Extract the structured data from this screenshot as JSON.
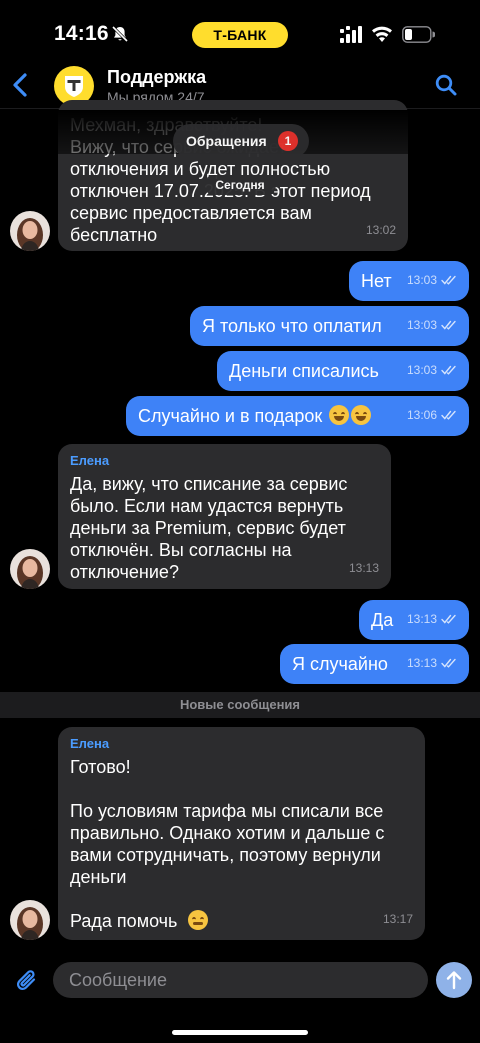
{
  "status_bar": {
    "time": "14:16",
    "carrier_pill": "Т-БАНК",
    "icons": [
      "bell-slash-icon",
      "signal-icon",
      "wifi-icon",
      "battery-icon"
    ]
  },
  "header": {
    "title": "Поддержка",
    "subtitle": "Мы рядом 24/7",
    "logo_letter": "Т"
  },
  "overlay": {
    "appeals_label": "Обращения",
    "appeals_count": "1",
    "date_label": "Сегодня"
  },
  "messages": [
    {
      "direction": "in",
      "text": "Мехман, здравствуйте!\nВижу, что сервис ожидает\nотключения и будет полностью\nотключен 17.07.2025. В этот период\nсервис предоставляется вам\nбесплатно",
      "time": "13:02"
    },
    {
      "direction": "out",
      "text": "Нет",
      "time": "13:03"
    },
    {
      "direction": "out",
      "text": "Я только что оплатил",
      "time": "13:03"
    },
    {
      "direction": "out",
      "text": "Деньги списались",
      "time": "13:03"
    },
    {
      "direction": "out",
      "text": "Случайно и в подарок",
      "emoji": "😂😂",
      "time": "13:06"
    },
    {
      "direction": "in",
      "sender": "Елена",
      "text": "Да, вижу, что списание за сервис\nбыло. Если нам удастся вернуть\nденьги за Premium, сервис будет\nотключён. Вы согласны на\nотключение?",
      "time": "13:13"
    },
    {
      "direction": "out",
      "text": "Да",
      "time": "13:13"
    },
    {
      "direction": "out",
      "text": "Я случайно",
      "time": "13:13"
    },
    {
      "direction": "in",
      "sender": "Елена",
      "text": "Готово!\n\nПо условиям тарифа мы списали все\nправильно. Однако хотим и дальше с\nвами сотрудничать, поэтому вернули\nденьги\n\nРада помочь",
      "emoji": "😉",
      "time": "13:17"
    }
  ],
  "divider_label": "Новые сообщения",
  "composer": {
    "placeholder": "Сообщение"
  },
  "colors": {
    "accent_yellow": "#ffdd2d",
    "outgoing_bubble": "#3e82f7",
    "incoming_bubble": "#2c2c2e",
    "sender_name": "#4b9cff",
    "badge_red": "#e5322d"
  }
}
